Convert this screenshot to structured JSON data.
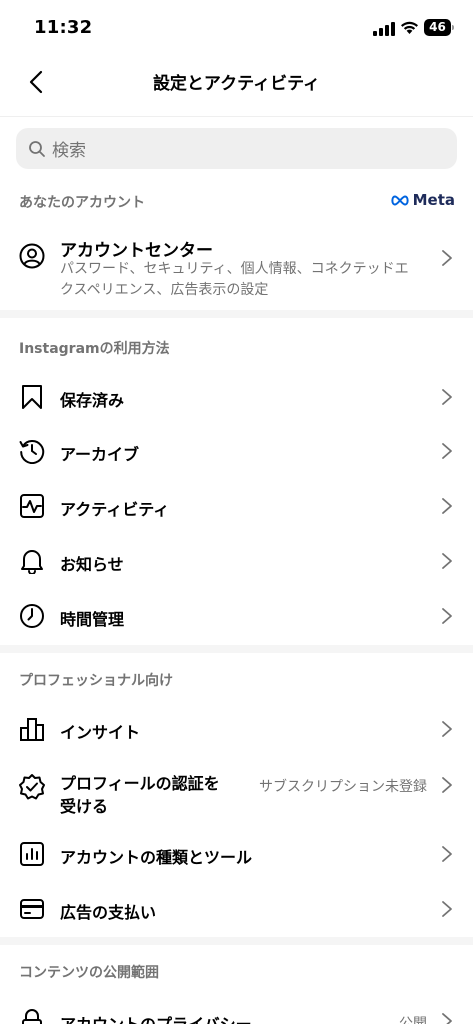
{
  "status_bar": {
    "time": "11:32",
    "battery": "46"
  },
  "nav": {
    "title": "設定とアクティビティ"
  },
  "search": {
    "placeholder": "検索"
  },
  "sections": {
    "your_account": "あなたのアカウント",
    "how_you_use": "Instagramの利用方法",
    "for_professionals": "プロフェッショナル向け",
    "content_visibility": "コンテンツの公開範囲"
  },
  "meta": {
    "label": "Meta"
  },
  "account_center": {
    "title": "アカウントセンター",
    "subtitle": "パスワード、セキュリティ、個人情報、コネクテッドエクスペリエンス、広告表示の設定"
  },
  "items": {
    "saved": "保存済み",
    "archive": "アーカイブ",
    "activity": "アクティビティ",
    "notifications": "お知らせ",
    "time_management": "時間管理",
    "insights": "インサイト",
    "verification_line1": "プロフィールの認証を",
    "verification_line2": "受ける",
    "verification_value": "サブスクリプション未登録",
    "account_type": "アカウントの種類とツール",
    "ad_payments": "広告の支払い",
    "account_privacy": "アカウントのプライバシー",
    "account_privacy_value": "公開"
  }
}
